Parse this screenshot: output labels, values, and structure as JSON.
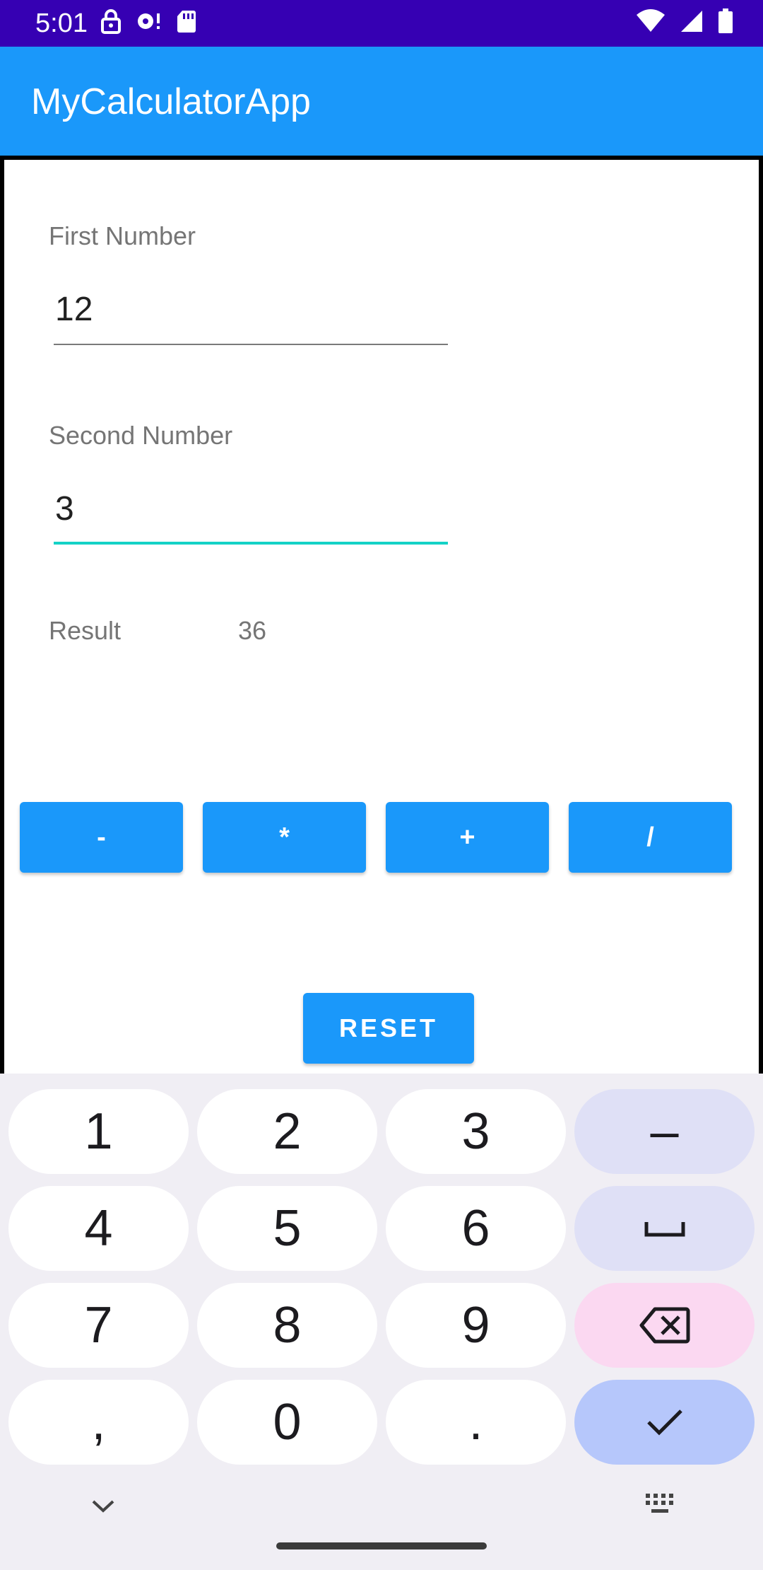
{
  "status_bar": {
    "time": "5:01",
    "icons_left": [
      "lock-icon",
      "hotspot-icon",
      "sd-card-icon"
    ],
    "icons_right": [
      "wifi-icon",
      "signal-icon",
      "battery-icon"
    ]
  },
  "app_bar": {
    "title": "MyCalculatorApp"
  },
  "form": {
    "first_label": "First Number",
    "first_value": "12",
    "second_label": "Second Number",
    "second_value": "3",
    "result_label": "Result",
    "result_value": "36"
  },
  "operations": [
    "-",
    "*",
    "+",
    "/"
  ],
  "reset_label": "RESET",
  "keyboard": {
    "rows": [
      [
        "1",
        "2",
        "3"
      ],
      [
        "4",
        "5",
        "6"
      ],
      [
        "7",
        "8",
        "9"
      ],
      [
        ",",
        "0",
        "."
      ]
    ],
    "side_keys": [
      "minus-key",
      "space-key",
      "backspace-key",
      "done-key"
    ],
    "minus_label": "–",
    "bottom_icons": [
      "collapse-keyboard-icon",
      "switch-keyboard-icon"
    ]
  },
  "colors": {
    "status_bar": "#3600b3",
    "accent": "#1a98fa",
    "focus_underline": "#14d2c6",
    "keyboard_bg": "#f0eef4"
  }
}
